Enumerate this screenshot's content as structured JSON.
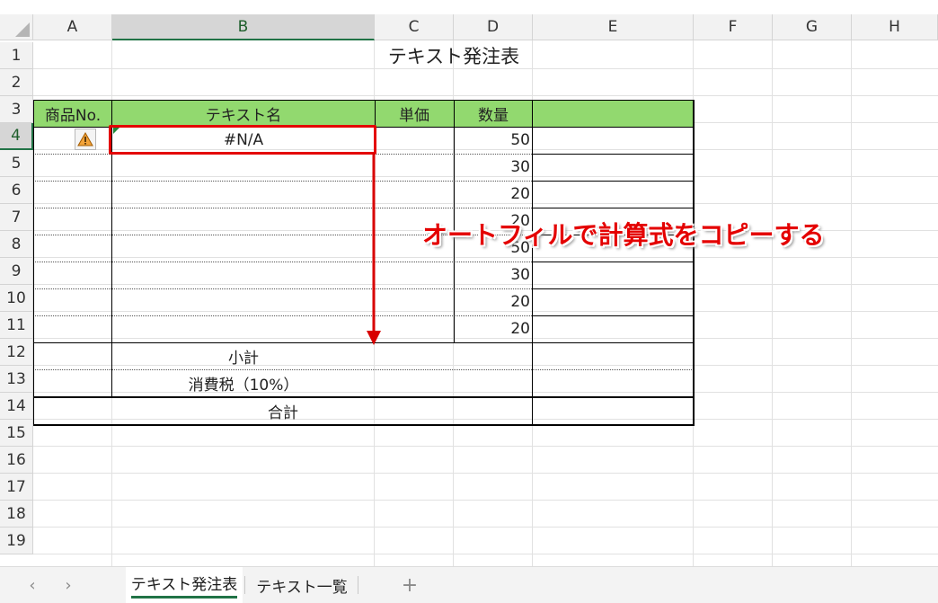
{
  "columns": [
    "A",
    "B",
    "C",
    "D",
    "E",
    "F",
    "G",
    "H"
  ],
  "rows": [
    "1",
    "2",
    "3",
    "4",
    "5",
    "6",
    "7",
    "8",
    "9",
    "10",
    "11",
    "12",
    "13",
    "14",
    "15",
    "16",
    "17",
    "18",
    "19"
  ],
  "title": "テキスト発注表",
  "headers": {
    "product_no": "商品No.",
    "text_name": "テキスト名",
    "unit_price": "単価",
    "quantity": "数量",
    "extra": ""
  },
  "cell_b4": "#N/A",
  "quantities": [
    "50",
    "30",
    "20",
    "20",
    "50",
    "30",
    "20",
    "20"
  ],
  "subtotal_label": "小計",
  "tax_label": "消費税（10%）",
  "total_label": "合計",
  "annotation": "オートフィルで計算式をコピーする",
  "tabs": [
    {
      "label": "テキスト発注表",
      "active": true
    },
    {
      "label": "テキスト一覧",
      "active": false
    }
  ],
  "colors": {
    "header_fill": "#92d96f",
    "highlight_box": "#e40000",
    "arrow": "#d80000",
    "selected_accent": "#217346"
  },
  "icons": {
    "warning": "warning-icon",
    "prev": "chevron-left-icon",
    "next": "chevron-right-icon",
    "add": "plus-icon"
  }
}
